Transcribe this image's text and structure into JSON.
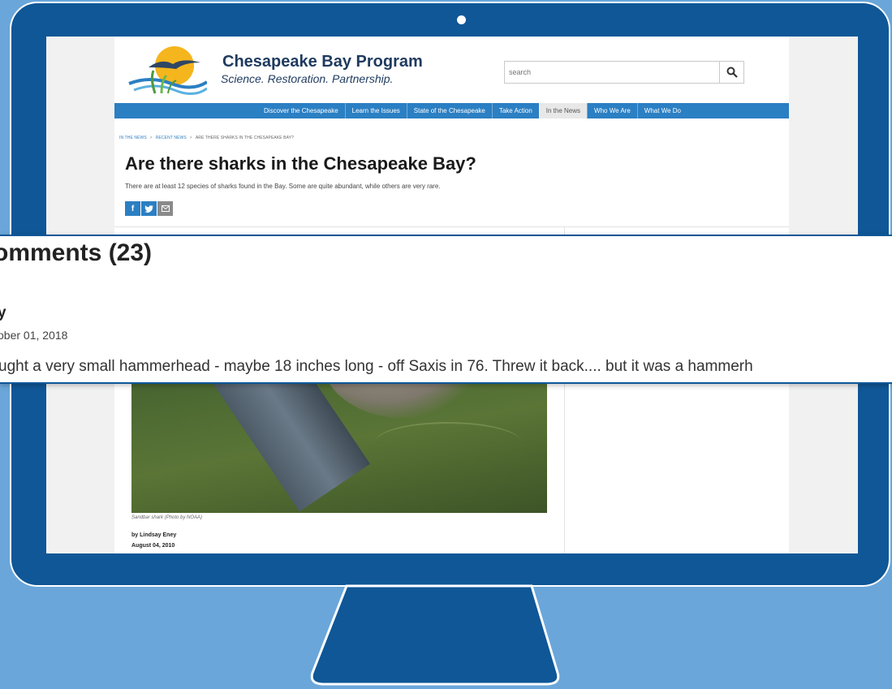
{
  "site": {
    "name": "Chesapeake Bay Program",
    "tagline": "Science. Restoration. Partnership."
  },
  "search": {
    "placeholder": "search",
    "icon": "magnifier-icon"
  },
  "nav": {
    "items": [
      {
        "label": "Discover the Chesapeake"
      },
      {
        "label": "Learn the Issues"
      },
      {
        "label": "State of the Chesapeake"
      },
      {
        "label": "Take Action"
      },
      {
        "label": "In the News"
      },
      {
        "label": "Who We Are"
      },
      {
        "label": "What We Do"
      }
    ],
    "active": "In the News"
  },
  "breadcrumb": {
    "items": [
      "IN THE NEWS",
      "RECENT NEWS",
      "ARE THERE SHARKS IN THE CHESAPEAKE BAY?"
    ],
    "separator": ">"
  },
  "article": {
    "title": "Are there sharks in the Chesapeake Bay?",
    "subtitle": "There are at least 12 species of sharks found in the Bay. Some are quite abundant, while others are very rare.",
    "caption": "Sandbar shark (Photo by NOAA)",
    "byline": "by Lindsay Eney",
    "date": "August 04, 2010"
  },
  "share": {
    "facebook": "f",
    "twitter": "t",
    "email_icon": "envelope-icon"
  },
  "comments_zoom": {
    "heading": "omments (23)",
    "author": "y",
    "date": "ober 01, 2018",
    "body": "ught a very small hammerhead - maybe 18 inches long - off Saxis in 76. Threw it back.... but it was a hammerh"
  },
  "colors": {
    "background": "#6aa6da",
    "monitor": "#0f5797",
    "nav": "#2b7fc3",
    "title": "#1e3a5f"
  }
}
